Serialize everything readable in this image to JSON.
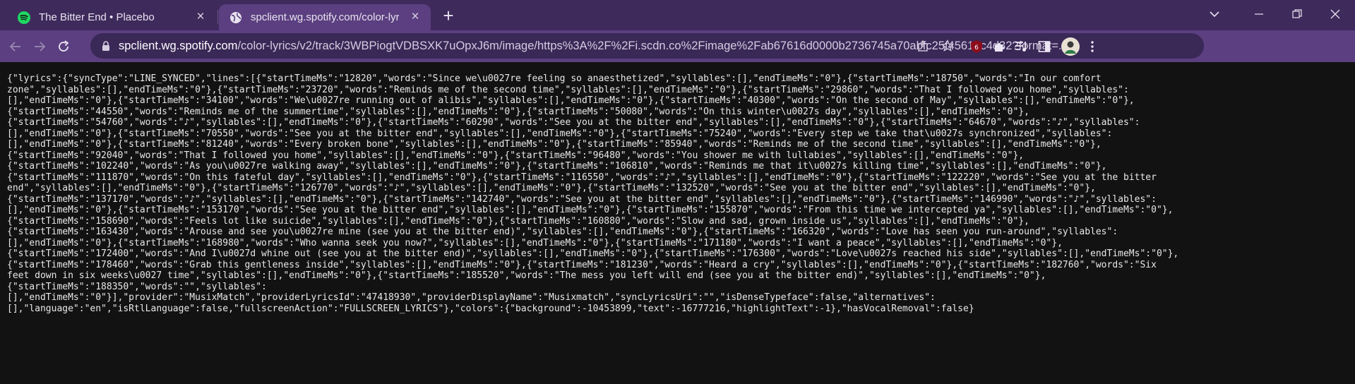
{
  "browser": {
    "tabs": [
      {
        "title": "The Bitter End • Placebo",
        "active": false,
        "icon": "spotify-icon"
      },
      {
        "title": "spclient.wg.spotify.com/color-lyr",
        "active": true,
        "icon": "globe-icon"
      }
    ],
    "new_tab_label": "+",
    "window_controls": [
      "chevron-down-icon",
      "minimize-icon",
      "restore-icon",
      "close-icon"
    ],
    "address": {
      "host": "spclient.wg.spotify.com",
      "path": "/color-lyrics/v2/track/3WBPiogtVDBSXK7uOpxJ6m/image/https%3A%2F%2Fi.scdn.co%2Fimage%2Fab67616d0000b2736745a70abfc25f45612c4d32?format=..."
    },
    "colors": {
      "tabstrip": "#3f2a5c",
      "toolbar": "#5b3f80",
      "omnibox": "#3a2857",
      "page_background": "#121212",
      "text": "#e8e8e8"
    }
  },
  "content": {
    "lines": [
      "{\"lyrics\":{\"syncType\":\"LINE_SYNCED\",\"lines\":[{\"startTimeMs\":\"12820\",\"words\":\"Since we\\u0027re feeling so anaesthetized\",\"syllables\":[],\"endTimeMs\":\"0\"},{\"startTimeMs\":\"18750\",\"words\":\"In our comfort",
      "zone\",\"syllables\":[],\"endTimeMs\":\"0\"},{\"startTimeMs\":\"23720\",\"words\":\"Reminds me of the second time\",\"syllables\":[],\"endTimeMs\":\"0\"},{\"startTimeMs\":\"29860\",\"words\":\"That I followed you home\",\"syllables\":",
      "[],\"endTimeMs\":\"0\"},{\"startTimeMs\":\"34100\",\"words\":\"We\\u0027re running out of alibis\",\"syllables\":[],\"endTimeMs\":\"0\"},{\"startTimeMs\":\"40300\",\"words\":\"On the second of May\",\"syllables\":[],\"endTimeMs\":\"0\"},",
      "{\"startTimeMs\":\"44550\",\"words\":\"Reminds me of the summertime\",\"syllables\":[],\"endTimeMs\":\"0\"},{\"startTimeMs\":\"50080\",\"words\":\"On this winter\\u0027s day\",\"syllables\":[],\"endTimeMs\":\"0\"},",
      "{\"startTimeMs\":\"54760\",\"words\":\"♪\",\"syllables\":[],\"endTimeMs\":\"0\"},{\"startTimeMs\":\"60290\",\"words\":\"See you at the bitter end\",\"syllables\":[],\"endTimeMs\":\"0\"},{\"startTimeMs\":\"64670\",\"words\":\"♪\",\"syllables\":",
      "[],\"endTimeMs\":\"0\"},{\"startTimeMs\":\"70550\",\"words\":\"See you at the bitter end\",\"syllables\":[],\"endTimeMs\":\"0\"},{\"startTimeMs\":\"75240\",\"words\":\"Every step we take that\\u0027s synchronized\",\"syllables\":",
      "[],\"endTimeMs\":\"0\"},{\"startTimeMs\":\"81240\",\"words\":\"Every broken bone\",\"syllables\":[],\"endTimeMs\":\"0\"},{\"startTimeMs\":\"85940\",\"words\":\"Reminds me of the second time\",\"syllables\":[],\"endTimeMs\":\"0\"},",
      "{\"startTimeMs\":\"92040\",\"words\":\"That I followed you home\",\"syllables\":[],\"endTimeMs\":\"0\"},{\"startTimeMs\":\"96480\",\"words\":\"You shower me with lullabies\",\"syllables\":[],\"endTimeMs\":\"0\"},",
      "{\"startTimeMs\":\"102240\",\"words\":\"As you\\u0027re walking away\",\"syllables\":[],\"endTimeMs\":\"0\"},{\"startTimeMs\":\"106810\",\"words\":\"Reminds me that it\\u0027s killing time\",\"syllables\":[],\"endTimeMs\":\"0\"},",
      "{\"startTimeMs\":\"111870\",\"words\":\"On this fateful day\",\"syllables\":[],\"endTimeMs\":\"0\"},{\"startTimeMs\":\"116550\",\"words\":\"♪\",\"syllables\":[],\"endTimeMs\":\"0\"},{\"startTimeMs\":\"122220\",\"words\":\"See you at the bitter",
      "end\",\"syllables\":[],\"endTimeMs\":\"0\"},{\"startTimeMs\":\"126770\",\"words\":\"♪\",\"syllables\":[],\"endTimeMs\":\"0\"},{\"startTimeMs\":\"132520\",\"words\":\"See you at the bitter end\",\"syllables\":[],\"endTimeMs\":\"0\"},",
      "{\"startTimeMs\":\"137170\",\"words\":\"♪\",\"syllables\":[],\"endTimeMs\":\"0\"},{\"startTimeMs\":\"142740\",\"words\":\"See you at the bitter end\",\"syllables\":[],\"endTimeMs\":\"0\"},{\"startTimeMs\":\"146990\",\"words\":\"♪\",\"syllables\":",
      "[],\"endTimeMs\":\"0\"},{\"startTimeMs\":\"153170\",\"words\":\"See you at the bitter end\",\"syllables\":[],\"endTimeMs\":\"0\"},{\"startTimeMs\":\"155870\",\"words\":\"From this time we intercepted ya\",\"syllables\":[],\"endTimeMs\":\"0\"},",
      "{\"startTimeMs\":\"158690\",\"words\":\"Feels lot like suicide\",\"syllables\":[],\"endTimeMs\":\"0\"},{\"startTimeMs\":\"160880\",\"words\":\"Slow and sad, grown inside us\",\"syllables\":[],\"endTimeMs\":\"0\"},",
      "{\"startTimeMs\":\"163430\",\"words\":\"Arouse and see you\\u0027re mine (see you at the bitter end)\",\"syllables\":[],\"endTimeMs\":\"0\"},{\"startTimeMs\":\"166320\",\"words\":\"Love has seen you run-around\",\"syllables\":",
      "[],\"endTimeMs\":\"0\"},{\"startTimeMs\":\"168980\",\"words\":\"Who wanna seek you now?\",\"syllables\":[],\"endTimeMs\":\"0\"},{\"startTimeMs\":\"171180\",\"words\":\"I want a peace\",\"syllables\":[],\"endTimeMs\":\"0\"},",
      "{\"startTimeMs\":\"172400\",\"words\":\"And I\\u0027d whine out (see you at the bitter end)\",\"syllables\":[],\"endTimeMs\":\"0\"},{\"startTimeMs\":\"176300\",\"words\":\"Love\\u0027s reached his side\",\"syllables\":[],\"endTimeMs\":\"0\"},",
      "{\"startTimeMs\":\"178460\",\"words\":\"Grab this gentleness inside\",\"syllables\":[],\"endTimeMs\":\"0\"},{\"startTimeMs\":\"181230\",\"words\":\"Heard a cry\",\"syllables\":[],\"endTimeMs\":\"0\"},{\"startTimeMs\":\"182760\",\"words\":\"Six",
      "feet down in six weeks\\u0027 time\",\"syllables\":[],\"endTimeMs\":\"0\"},{\"startTimeMs\":\"185520\",\"words\":\"The mess you left will end (see you at the bitter end)\",\"syllables\":[],\"endTimeMs\":\"0\"},",
      "{\"startTimeMs\":\"188350\",\"words\":\"\",\"syllables\":",
      "[],\"endTimeMs\":\"0\"}],\"provider\":\"MusixMatch\",\"providerLyricsId\":\"47418930\",\"providerDisplayName\":\"Musixmatch\",\"syncLyricsUri\":\"\",\"isDenseTypeface\":false,\"alternatives\":",
      "[],\"language\":\"en\",\"isRtlLanguage\":false,\"fullscreenAction\":\"FULLSCREEN_LYRICS\"},\"colors\":{\"background\":-10453899,\"text\":-16777216,\"highlightText\":-1},\"hasVocalRemoval\":false}"
    ]
  }
}
